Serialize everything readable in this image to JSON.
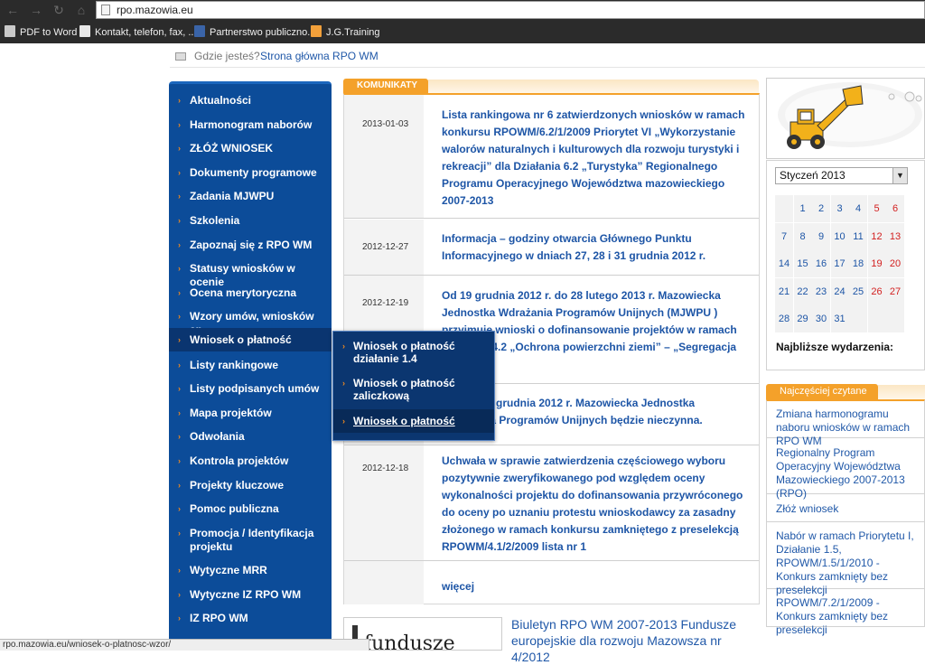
{
  "browser": {
    "url": "rpo.mazowia.eu",
    "bookmarks": [
      "PDF to Word",
      "Kontakt, telefon, fax, ...",
      "Partnerstwo publiczno...",
      "J.G.Training"
    ]
  },
  "breadcrumb": {
    "label": "Gdzie jesteś?",
    "link": "Strona główna RPO WM"
  },
  "sidebar": {
    "items": [
      "Aktualności",
      "Harmonogram naborów",
      "ZŁÓŻ WNIOSEK",
      "Dokumenty programowe",
      "Zadania MJWPU",
      "Szkolenia",
      "Zapoznaj się z RPO WM",
      "Statusy wniosków w ocenie",
      "Ocena merytoryczna",
      "Wzory umów, wniosków ap.",
      "Wniosek o płatność",
      "Listy rankingowe",
      "Listy podpisanych umów",
      "Mapa projektów",
      "Odwołania",
      "Kontrola projektów",
      "Projekty kluczowe",
      "Pomoc publiczna",
      "Promocja / Identyfikacja projektu",
      "Wytyczne MRR",
      "Wytyczne IZ RPO WM",
      "IZ RPO WM"
    ],
    "submenu": [
      "Wniosek o płatność działanie 1.4",
      "Wniosek o płatność zaliczkową",
      "Wniosek o płatność"
    ]
  },
  "komunikaty": {
    "title": "KOMUNIKATY",
    "rows": [
      {
        "date": "2013-01-03",
        "text": "Lista rankingowa nr 6 zatwierdzonych wniosków w ramach konkursu RPOWM/6.2/1/2009 Priorytet VI „Wykorzystanie walorów naturalnych i kulturowych dla rozwoju turystyki i rekreacji” dla Działania 6.2 „Turystyka” Regionalnego Programu Operacyjnego Województwa mazowieckiego 2007-2013"
      },
      {
        "date": "2012-12-27",
        "text": "Informacja – godziny otwarcia Głównego Punktu Informacyjnego w dniach 27, 28 i 31 grudnia 2012 r."
      },
      {
        "date": "2012-12-19",
        "text": "Od 19 grudnia 2012 r. do 28 lutego 2013 r. Mazowiecka Jednostka Wdrażania Programów Unijnych (MJWPU ) przyjmuje wnioski o dofinansowanie projektów w ramach Działania 4.2 „Ochrona powierzchni ziemi” – „Segregacja odpadów”"
      },
      {
        "date": "",
        "text": "W dniu 24 grudnia 2012 r. Mazowiecka Jednostka Wdrażania Programów Unijnych będzie nieczynna."
      },
      {
        "date": "2012-12-18",
        "text": "Uchwała w sprawie zatwierdzenia częściowego wyboru pozytywnie zweryfikowanego pod względem oceny wykonalności projektu do dofinansowania przywróconego do oceny po uznaniu protestu wnioskodawcy za zasadny złożonego w ramach konkursu zamkniętego z preselekcją RPOWM/4.1/2/2009 lista nr 1"
      }
    ],
    "more": "więcej"
  },
  "bulletin": {
    "title": "Biuletyn RPO WM 2007-2013 Fundusze europejskie dla rozwoju Mazowsza nr 4/2012",
    "image_text": "fundusze"
  },
  "calendar": {
    "month": "Styczeń 2013",
    "weeks": [
      [
        "",
        "1",
        "2",
        "3",
        "4",
        "5",
        "6"
      ],
      [
        "7",
        "8",
        "9",
        "10",
        "11",
        "12",
        "13"
      ],
      [
        "14",
        "15",
        "16",
        "17",
        "18",
        "19",
        "20"
      ],
      [
        "21",
        "22",
        "23",
        "24",
        "25",
        "26",
        "27"
      ],
      [
        "28",
        "29",
        "30",
        "31",
        "",
        "",
        ""
      ]
    ],
    "events_label": "Najbliższe wydarzenia:"
  },
  "popular": {
    "title": "Najczęściej czytane",
    "items": [
      "Zmiana harmonogramu naboru wniosków w ramach RPO WM",
      "Regionalny Program Operacyjny Województwa Mazowieckiego 2007-2013 (RPO)",
      "Złóż wniosek",
      "Nabór w ramach Priorytetu I, Działanie 1.5, RPOWM/1.5/1/2010 - Konkurs zamknięty bez preselekcji",
      "RPOWM/7.2/1/2009 - Konkurs zamknięty bez preselekcji"
    ]
  },
  "status_bar": {
    "text": "rpo.mazowia.eu/wniosek-o-platnosc-wzor/"
  },
  "colors": {
    "sidebar": "#0c4c99",
    "accent": "#f4a12a",
    "link": "#1d55a6",
    "weekend": "#d32020"
  }
}
